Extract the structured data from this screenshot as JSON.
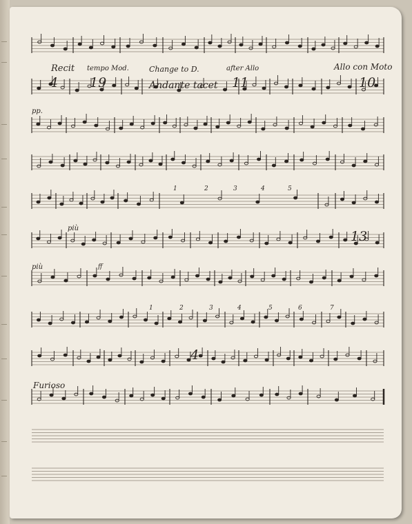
{
  "annotations": {
    "recit": "Recit",
    "tempo": "tempo Mod.",
    "change": "Change to D.",
    "after": "after Allo",
    "allo": "Allo con Moto",
    "andante": "Andante tacet",
    "pp": "pp.",
    "piu1": "più",
    "piu2": "più",
    "furioso": "Furioso",
    "ff": "ff"
  },
  "rests": {
    "r4": "4",
    "r19": "19",
    "r11": "11",
    "r10": "10",
    "r13": "13",
    "r4b": "4"
  },
  "counters": {
    "c1": "1",
    "c2": "2",
    "c3": "3",
    "c4": "4",
    "c5": "5",
    "d1": "1",
    "d2": "2",
    "d3": "3",
    "d4": "4",
    "d5": "5",
    "d6": "6",
    "d7": "7"
  }
}
